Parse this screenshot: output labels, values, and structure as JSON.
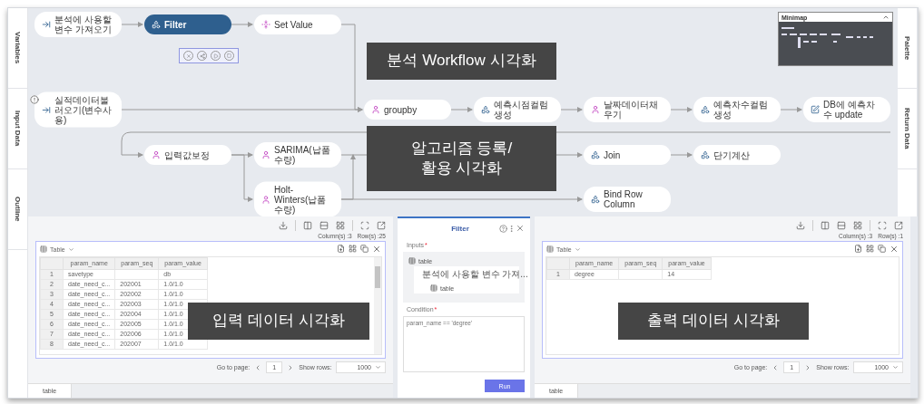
{
  "side_tabs_left": [
    {
      "label": "Variables"
    },
    {
      "label": "Input Data"
    },
    {
      "label": "Outline"
    }
  ],
  "side_tabs_right": [
    {
      "label": "Palette"
    },
    {
      "label": "Return Data"
    }
  ],
  "workflow": {
    "lanes": [
      {
        "nodes": [
          {
            "label": "분석에 사용할 변수 가져오기",
            "kind": "input",
            "selected": false,
            "alert": false
          },
          {
            "label": "Filter",
            "kind": "filter",
            "selected": true,
            "alert": false
          },
          {
            "label": "Set Value",
            "kind": "set",
            "selected": false,
            "alert": false
          }
        ]
      },
      {
        "nodes": [
          {
            "label": "실적데이터불러오기(변수사용)",
            "kind": "input",
            "selected": false,
            "alert": true
          },
          {
            "label": "groupby",
            "kind": "user",
            "selected": false,
            "alert": false
          },
          {
            "label": "예측시점컬럼생성",
            "kind": "filter",
            "selected": false,
            "alert": false
          },
          {
            "label": "날짜데이터채우기",
            "kind": "user",
            "selected": false,
            "alert": false
          },
          {
            "label": "예측차수컬럼 생성",
            "kind": "filter",
            "selected": false,
            "alert": false
          },
          {
            "label": "DB에 예측차수 update",
            "kind": "update",
            "selected": false,
            "alert": false
          }
        ]
      },
      {
        "nodes": [
          {
            "label": "입력값보정",
            "kind": "user",
            "selected": false,
            "alert": false
          },
          {
            "label": "SARIMA(납품수량)",
            "kind": "user",
            "selected": false,
            "alert": false
          },
          {
            "label": "Join",
            "kind": "filter",
            "selected": false,
            "alert": false
          },
          {
            "label": "단기계산",
            "kind": "filter",
            "selected": false,
            "alert": false
          }
        ]
      },
      {
        "nodes": [
          {
            "label": "Holt-Winters(납품수량)",
            "kind": "user",
            "selected": false,
            "alert": false
          },
          {
            "label": "Bind Row Column",
            "kind": "filter",
            "selected": false,
            "alert": false
          }
        ]
      }
    ]
  },
  "minimap": {
    "title": "Minimap",
    "expanded": true
  },
  "captions": [
    {
      "text": "분석 Workflow 시각화"
    },
    {
      "text": "알고리즘 등록/\n활용 시각화"
    },
    {
      "text": "입력 데이터  시각화"
    },
    {
      "text": "출력 데이터  시각화"
    }
  ],
  "input_panel": {
    "columns_count": "Column(s) :3",
    "rows_count": "Row(s) :25",
    "card_title": "Table",
    "columns": [
      "param_name",
      "param_seq",
      "param_value"
    ],
    "rows": [
      {
        "index": "1",
        "cells": [
          "savetype",
          "",
          "db"
        ]
      },
      {
        "index": "2",
        "cells": [
          "date_need_c...",
          "202001",
          "1.0/1.0"
        ]
      },
      {
        "index": "3",
        "cells": [
          "date_need_c...",
          "202002",
          "1.0/1.0"
        ]
      },
      {
        "index": "4",
        "cells": [
          "date_need_c...",
          "202003",
          "1.0/1.0"
        ]
      },
      {
        "index": "5",
        "cells": [
          "date_need_c...",
          "202004",
          "1.0/1.0"
        ]
      },
      {
        "index": "6",
        "cells": [
          "date_need_c...",
          "202005",
          "1.0/1.0"
        ]
      },
      {
        "index": "7",
        "cells": [
          "date_need_c...",
          "202006",
          "1.0/1.0"
        ]
      },
      {
        "index": "8",
        "cells": [
          "date_need_c...",
          "202007",
          "1.0/1.0"
        ]
      }
    ],
    "pager": {
      "label": "Go to page:",
      "page": "1",
      "rows_label": "Show rows:",
      "rows": "1000"
    },
    "tabs": [
      {
        "label": "table",
        "selected": true
      }
    ]
  },
  "filter_panel": {
    "title": "Filter",
    "inputs": {
      "label": "Inputs",
      "required_mark": "*",
      "tree": [
        {
          "label": "table",
          "children": [
            {
              "label": "분석에 사용할 변수 가져...",
              "children": [
                {
                  "label": "table"
                }
              ]
            }
          ]
        }
      ]
    },
    "condition": {
      "label": "Condition",
      "required_mark": "*",
      "placeholder": "param_name == 'degree'"
    },
    "run_button": "Run"
  },
  "output_panel": {
    "columns_count": "Column(s) :3",
    "rows_count": "Row(s) :1",
    "card_title": "Table",
    "columns": [
      "param_name",
      "param_seq",
      "param_value"
    ],
    "rows": [
      {
        "index": "1",
        "cells": [
          "degree",
          "",
          "14"
        ]
      }
    ],
    "pager": {
      "label": "Go to page:",
      "page": "1",
      "rows_label": "Show rows:",
      "rows": "1000"
    },
    "tabs": [
      {
        "label": "table",
        "selected": true
      }
    ]
  }
}
